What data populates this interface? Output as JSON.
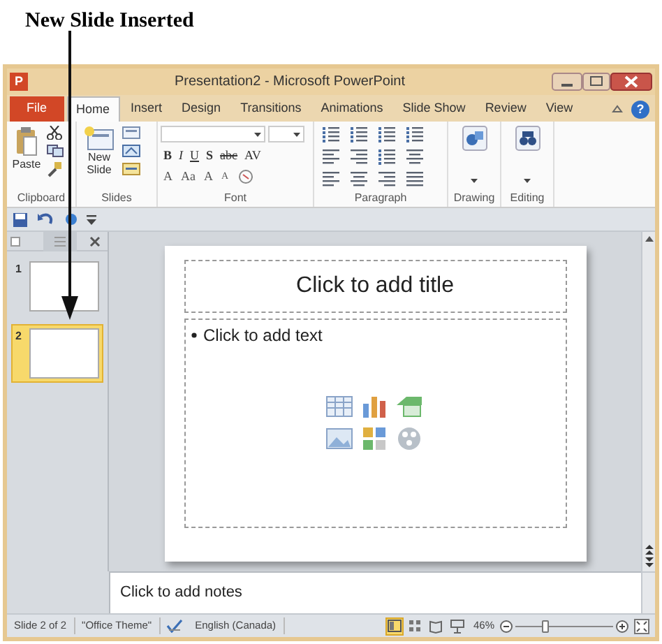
{
  "annotation": {
    "label": "New Slide Inserted"
  },
  "window": {
    "icon_label": "P",
    "title": "Presentation2 - Microsoft PowerPoint"
  },
  "tabs": [
    {
      "label": "File",
      "kind": "file",
      "selected": false
    },
    {
      "label": "Home",
      "kind": "tab",
      "selected": true
    },
    {
      "label": "Insert",
      "kind": "tab",
      "selected": false
    },
    {
      "label": "Design",
      "kind": "tab",
      "selected": false
    },
    {
      "label": "Transitions",
      "kind": "tab",
      "selected": false
    },
    {
      "label": "Animations",
      "kind": "tab",
      "selected": false
    },
    {
      "label": "Slide Show",
      "kind": "tab",
      "selected": false
    },
    {
      "label": "Review",
      "kind": "tab",
      "selected": false
    },
    {
      "label": "View",
      "kind": "tab",
      "selected": false
    }
  ],
  "help_label": "?",
  "ribbon": {
    "clipboard": {
      "label": "Clipboard",
      "paste": "Paste"
    },
    "slides": {
      "label": "Slides",
      "new_slide": [
        "New",
        "Slide"
      ]
    },
    "font": {
      "label": "Font",
      "row_1": [
        "B",
        "I",
        "U",
        "S",
        "abc",
        "AV"
      ],
      "row_2": [
        "A",
        "Aa",
        "A",
        "A"
      ]
    },
    "paragraph": {
      "label": "Paragraph"
    },
    "drawing": {
      "label": "Drawing"
    },
    "editing": {
      "label": "Editing"
    }
  },
  "slides_pane": [
    {
      "number": "1",
      "selected": false
    },
    {
      "number": "2",
      "selected": true
    }
  ],
  "slide": {
    "title_placeholder": "Click to add title",
    "body_placeholder": "Click to add text"
  },
  "notes": {
    "placeholder": "Click to add notes"
  },
  "status_bar": {
    "slide": "Slide 2 of 2",
    "theme": "\"Office Theme\"",
    "language": "English (Canada)",
    "views": [
      {
        "kind": "normal",
        "selected": true
      },
      {
        "kind": "sorter",
        "selected": false
      },
      {
        "kind": "reading",
        "selected": false
      },
      {
        "kind": "slideshow",
        "selected": false
      }
    ],
    "zoom": {
      "reading": "46%",
      "level": 0.3
    }
  }
}
